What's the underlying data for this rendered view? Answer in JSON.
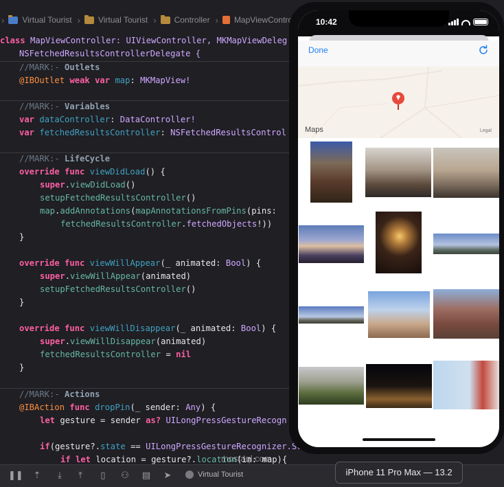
{
  "breadcrumb": [
    "Virtual Tourist",
    "Virtual Tourist",
    "Controller",
    "MapViewControll"
  ],
  "code": {
    "class_decl": {
      "kw": "class",
      "name": "MapViewController",
      "rest": ": UIViewController, MKMapViewDeleg"
    },
    "class_decl2": "NSFetchedResultsControllerDelegate {",
    "mark_outlets": "//MARK:- Outlets",
    "outlet_line": {
      "attr": "@IBOutlet",
      "kw": "weak var",
      "name": "map",
      "type": "MKMapView!"
    },
    "mark_variables": "//MARK:- Variables",
    "var1": {
      "kw": "var",
      "name": "dataController",
      "type": "DataController!"
    },
    "var2": {
      "kw": "var",
      "name": "fetchedResultsController",
      "type": "NSFetchedResultsControl"
    },
    "mark_lifecycle": "//MARK:- LifeCycle",
    "vdl": {
      "kw": "override func",
      "name": "viewDidLoad",
      "rest": "() {"
    },
    "vdl1": {
      "kw": "super",
      "call": "viewDidLoad",
      "rest": "()"
    },
    "vdl2": {
      "call": "setupFetchedResultsController",
      "rest": "()"
    },
    "vdl3": {
      "obj": "map",
      "call": "addAnnotations",
      "mid": "mapAnnotationsFromPins",
      "rest": "(pins:"
    },
    "vdl4": {
      "obj": "fetchedResultsController",
      "call": "fetchedObjects",
      "rest": "!))"
    },
    "close": "}",
    "vwa": {
      "kw": "override func",
      "name": "viewWillAppear",
      "arg": "_ animated:",
      "type": "Bool",
      "rest": ") {"
    },
    "vwa1": {
      "kw": "super",
      "call": "viewWillAppear",
      "rest": "(animated)"
    },
    "vwa2": {
      "call": "setupFetchedResultsController",
      "rest": "()"
    },
    "vwd": {
      "kw": "override func",
      "name": "viewWillDisappear",
      "arg": "_ animated:",
      "type": "Bool",
      "rest": ") {"
    },
    "vwd1": {
      "kw": "super",
      "call": "viewWillDisappear",
      "rest": "(animated)"
    },
    "vwd2": {
      "obj": "fetchedResultsController",
      "rest": " = ",
      "kw": "nil"
    },
    "mark_actions": "//MARK:- Actions",
    "drop": {
      "attr": "@IBAction",
      "kw": "func",
      "name": "dropPin",
      "arg": "_ sender:",
      "type": "Any",
      "rest": ") {"
    },
    "drop1": {
      "kw": "let",
      "rest": "gesture = sender",
      "kw2": "as?",
      "type": "UILongPressGestureRecogn"
    },
    "drop2": {
      "kw": "if",
      "rest": "(gesture?.",
      "prop": "state",
      "eq": " == ",
      "type": "UILongPressGestureRecognizer.Sc"
    },
    "drop3": {
      "kw": "if let",
      "rest": "location = gesture?.",
      "call": "location",
      "tail": "(in: map){"
    }
  },
  "debugbar": {
    "scheme": "Virtual Tourist"
  },
  "simulator_label": "iPhone 11 Pro Max — 13.2",
  "watermark": "mostaql.com",
  "phone": {
    "time": "10:42",
    "done_label": "Done",
    "maps_logo": "Maps",
    "legal": "Legal"
  },
  "colors": {
    "pin": "#e64a3c",
    "done": "#1e7cf6"
  },
  "photos": [
    {
      "name": "photo-rock-pool",
      "bg": "linear-gradient(180deg,#3a5aa8 0%,#7d6a58 35%,#5b3c2c 65%,#2f2418 100%)"
    },
    {
      "name": "photo-rocky-shore",
      "bg": "linear-gradient(180deg,#d8d4cf 0%,#a39585 45%,#5c4a3c 75%,#2e2a28 100%)"
    },
    {
      "name": "photo-coastal-town",
      "bg": "linear-gradient(180deg,#c9c4bd 0%,#b8a690 45%,#7a6a5c 75%,#3c342d 100%)"
    },
    {
      "name": "photo-sunset-sea",
      "bg": "linear-gradient(180deg,#5c7cb8 0%,#a0a8d0 40%,#ddbfa2 55%,#484060 80%,#262030 100%)"
    },
    {
      "name": "photo-candle-glass",
      "bg": "radial-gradient(circle at 52% 40%,#f5c86a 0%,#b07a3a 18%,#3a2418 45%,#150d0a 100%)"
    },
    {
      "name": "photo-horizon",
      "bg": "linear-gradient(180deg,#6c8ec8 0%,#b4c2de 55%,#5a6a62 80%,#3c4438 100%)"
    },
    {
      "name": "photo-beach-panorama",
      "bg": "linear-gradient(180deg,#5a7ac0 0%,#b8c8e2 60%,#6a6a60 80%,#3a3a34 100%)"
    },
    {
      "name": "photo-lighthouse-beach",
      "bg": "linear-gradient(180deg,#7aa4de 0%,#bed2ea 40%,#c8a88a 70%,#8c6a50 100%)"
    },
    {
      "name": "photo-red-cliff",
      "bg": "linear-gradient(180deg,#8eaed8 0%,#9c6e62 40%,#7a4a40 70%,#5a4036 100%)"
    },
    {
      "name": "photo-green-hills",
      "bg": "linear-gradient(180deg,#c7c8ca 0%,#9ea08f 40%,#5b6c3e 70%,#2e3c20 100%)"
    },
    {
      "name": "photo-night-plaza",
      "bg": "linear-gradient(180deg,#05050a 0%,#1a1410 50%,#8a6030 80%,#3a2a18 100%)"
    },
    {
      "name": "photo-child-beach",
      "bg": "linear-gradient(90deg,#bcd7ee 0%,#cfe0ee 55%,#c2483f 75%,#e8e0da 100%)"
    }
  ]
}
